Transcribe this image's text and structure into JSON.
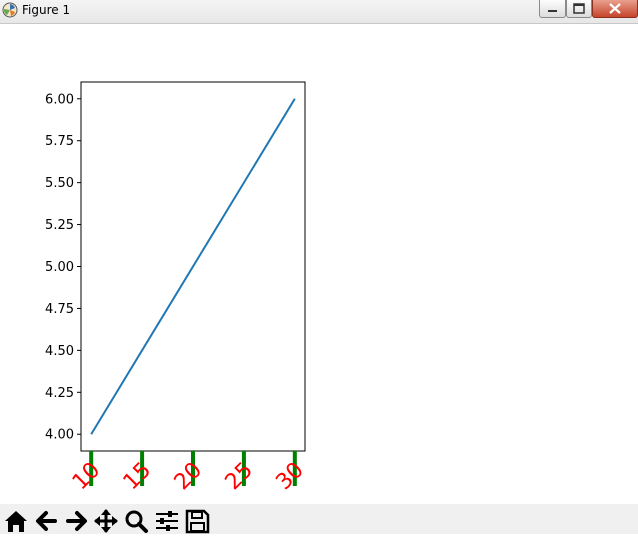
{
  "window": {
    "title": "Figure 1"
  },
  "toolbar": {
    "buttons": [
      {
        "icon": "home-icon"
      },
      {
        "icon": "back-arrow-icon"
      },
      {
        "icon": "forward-arrow-icon"
      },
      {
        "icon": "pan-icon"
      },
      {
        "icon": "zoom-icon"
      },
      {
        "icon": "configure-subplots-icon"
      },
      {
        "icon": "save-icon"
      }
    ]
  },
  "colors": {
    "line": "#1f77b4",
    "x_tick_marks": "#008000",
    "x_tick_labels": "#ff0000"
  },
  "chart_data": {
    "type": "line",
    "x": [
      10,
      30
    ],
    "y": [
      4.0,
      6.0
    ],
    "xlim": [
      9,
      31
    ],
    "ylim": [
      3.9,
      6.1
    ],
    "x_ticks": [
      "10",
      "15",
      "20",
      "25",
      "30"
    ],
    "y_ticks": [
      "4.00",
      "4.25",
      "4.50",
      "4.75",
      "5.00",
      "5.25",
      "5.50",
      "5.75",
      "6.00"
    ],
    "x_tick_label_rotation_deg": 45,
    "grid": false,
    "title": "",
    "xlabel": "",
    "ylabel": ""
  }
}
